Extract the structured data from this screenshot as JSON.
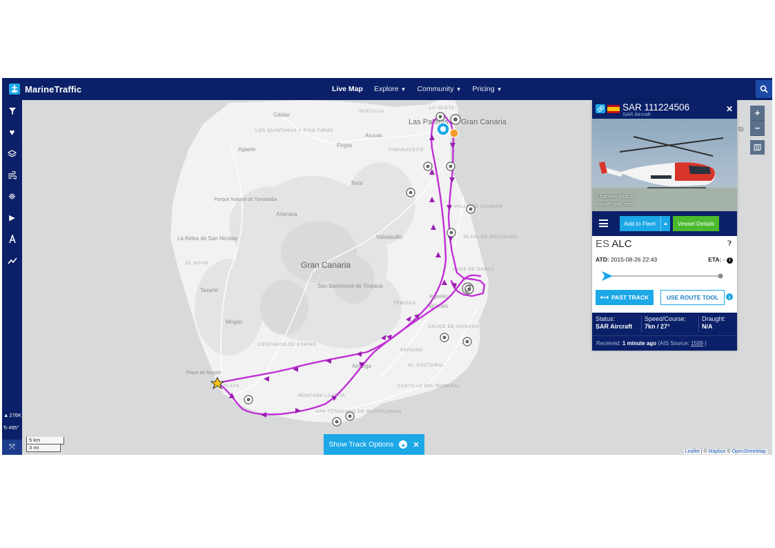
{
  "app": {
    "brand": "MarineTraffic",
    "nav": [
      {
        "label": "Live Map",
        "active": true,
        "caret": false
      },
      {
        "label": "Explore",
        "active": false,
        "caret": true
      },
      {
        "label": "Community",
        "active": false,
        "caret": true
      },
      {
        "label": "Pricing",
        "active": false,
        "caret": true
      }
    ],
    "colors": {
      "navy": "#0b2068",
      "accent": "#1ca7e7",
      "track": "#c02ed6",
      "green": "#4bba2e"
    }
  },
  "left_toolbar": {
    "tools": [
      "filter-icon",
      "heart-icon",
      "layers-icon",
      "wind-icon",
      "weather-icon",
      "play-icon",
      "route-icon",
      "analytics-icon"
    ],
    "vessel_count": "276K",
    "timer": "495\""
  },
  "map": {
    "island": "Gran Canaria",
    "places": [
      "Gáldar",
      "LOS QUINTANAS Y PISO FIRME",
      "Agaete",
      "Firgas",
      "Arucas",
      "SERTILLO",
      "TAMARACEITE",
      "Las Palmas de Gran Canaria",
      "LA ISLETA",
      "Teror",
      "Parque Natural de Tamadaba",
      "Artenara",
      "Valsequillo",
      "La Aldea de San Nicolás",
      "EL HOYO",
      "VALLE DE JINÁMAR",
      "PLAYA DE MELENARA",
      "OJOS DE GARZA",
      "San Bartolomé de Tirajana",
      "Tasarte",
      "Ingenio",
      "Agüimes",
      "TEMISAS",
      "Mogán",
      "CRUCE DE ARINAGA",
      "CERCADOS DE ESPINO",
      "SARDINA",
      "EL DOCTORAL",
      "Amurga",
      "Playa de Mogán",
      "PLAYA",
      "CASTILLO DEL ROMERAL",
      "MONTAÑA LA DATA",
      "SAN FERNANDO DE MASPALOMAS"
    ],
    "zoom_in": "+",
    "zoom_out": "−",
    "zoom_note": "5)",
    "scale_km": "5 km",
    "scale_mi": "3 mi",
    "attribution_leaflet": "Leaflet",
    "attribution_sep1": " | © ",
    "attribution_mapbox": "Mapbox",
    "attribution_sep2": " © ",
    "attribution_osm": "OpenStreetMap"
  },
  "track_options": {
    "label": "Show Track Options"
  },
  "vessel": {
    "name": "SAR 111224506",
    "type": "SAR Aircraft",
    "photo_credit_1": "© Nachete Muccio",
    "photo_credit_2": "MarineTraffic.com",
    "add_to_fleet": "Add to Fleet",
    "vessel_details": "Vessel Details",
    "destination_country": "ES",
    "destination": "ALC",
    "atd_label": "ATD:",
    "atd_value": "2015-08-26 22:43",
    "eta_label": "ETA:",
    "eta_value": "-",
    "past_track": "PAST TRACK",
    "route_tool": "USE ROUTE TOOL",
    "status_label": "Status:",
    "status_value": "SAR Aircraft",
    "speed_label": "Speed/Course:",
    "speed_value": "7kn / 27°",
    "draught_label": "Draught:",
    "draught_value": "N/A",
    "received_label": "Received:",
    "received_value": "1 minute ago",
    "ais_prefix": "(AIS Source:",
    "ais_source": "1589",
    "ais_suffix": ")"
  }
}
